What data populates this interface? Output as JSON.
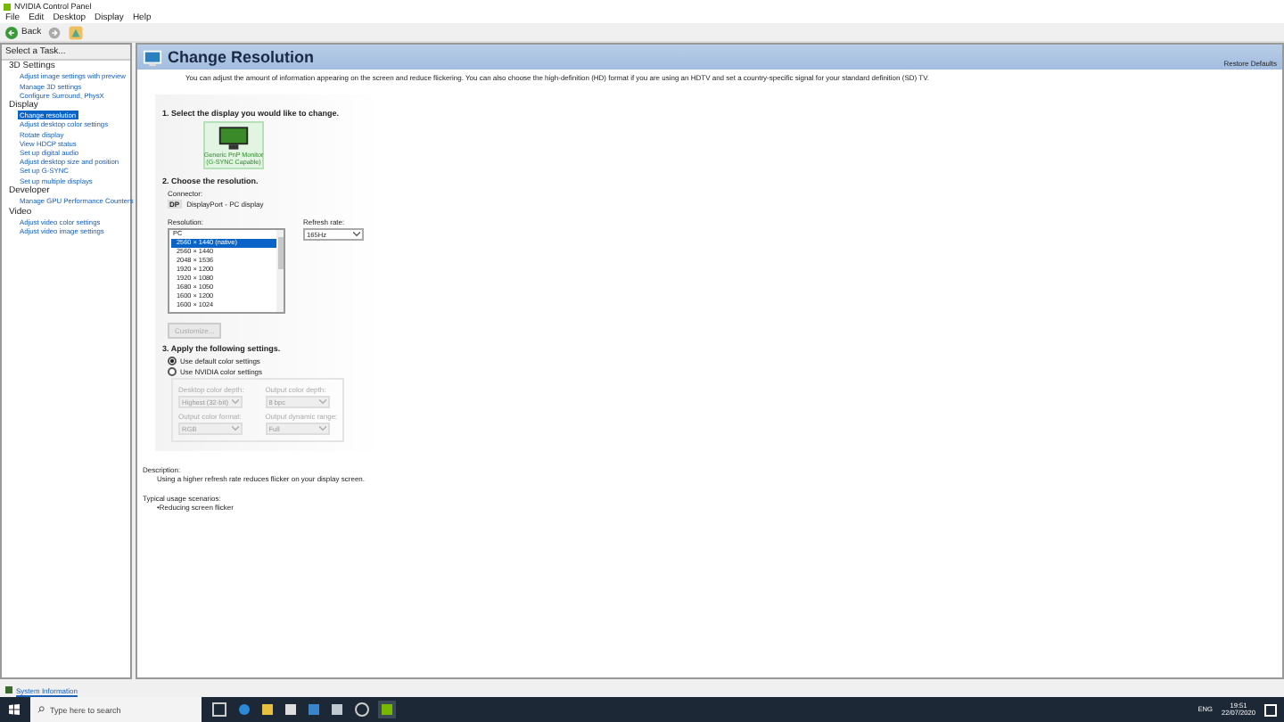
{
  "window": {
    "title": "NVIDIA Control Panel"
  },
  "menu": [
    "File",
    "Edit",
    "Desktop",
    "Display",
    "Help"
  ],
  "toolbar": {
    "back": "Back"
  },
  "sidebar": {
    "title": "Select a Task...",
    "items": [
      {
        "label": "3D Settings",
        "selected": false,
        "children": [
          {
            "label": "Adjust image settings with preview",
            "selected": false
          },
          {
            "label": "Manage 3D settings",
            "selected": false
          },
          {
            "label": "Configure Surround, PhysX",
            "selected": false
          }
        ]
      },
      {
        "label": "Display",
        "selected": false,
        "children": [
          {
            "label": "Change resolution",
            "selected": true
          },
          {
            "label": "Adjust desktop color settings",
            "selected": false
          },
          {
            "label": "Rotate display",
            "selected": false
          },
          {
            "label": "View HDCP status",
            "selected": false
          },
          {
            "label": "Set up digital audio",
            "selected": false
          },
          {
            "label": "Adjust desktop size and position",
            "selected": false
          },
          {
            "label": "Set up G-SYNC",
            "selected": false
          },
          {
            "label": "Set up multiple displays",
            "selected": false
          }
        ]
      },
      {
        "label": "Developer",
        "selected": false,
        "children": [
          {
            "label": "Manage GPU Performance Counters",
            "selected": false
          }
        ]
      },
      {
        "label": "Video",
        "selected": false,
        "children": [
          {
            "label": "Adjust video color settings",
            "selected": false
          },
          {
            "label": "Adjust video image settings",
            "selected": false
          }
        ]
      }
    ]
  },
  "page": {
    "title": "Change Resolution",
    "restore": "Restore Defaults",
    "intro": "You can adjust the amount of information appearing on the screen and reduce flickering. You can also choose the high-definition (HD) format if you are using an HDTV and set a country-specific signal for your standard definition (SD) TV.",
    "step1": "1. Select the display you would like to change.",
    "display": {
      "name": "Generic PnP Monitor",
      "sub": "(G-SYNC Capable)",
      "selected": true
    },
    "step2": "2. Choose the resolution.",
    "connector_label": "Connector:",
    "connector_badge": "DP",
    "connector": "DisplayPort - PC display",
    "resolution_label": "Resolution:",
    "resolution_group": "PC",
    "resolutions": [
      {
        "label": "2560 × 1440 (native)",
        "selected": true
      },
      {
        "label": "2560 × 1440",
        "selected": false
      },
      {
        "label": "2048 × 1536",
        "selected": false
      },
      {
        "label": "1920 × 1200",
        "selected": false
      },
      {
        "label": "1920 × 1080",
        "selected": false
      },
      {
        "label": "1680 × 1050",
        "selected": false
      },
      {
        "label": "1600 × 1200",
        "selected": false
      },
      {
        "label": "1600 × 1024",
        "selected": false
      }
    ],
    "refresh_label": "Refresh rate:",
    "refresh": "165Hz",
    "customize": "Customize...",
    "step3": "3. Apply the following settings.",
    "color_options": [
      {
        "label": "Use default color settings",
        "selected": true
      },
      {
        "label": "Use NVIDIA color settings",
        "selected": false
      }
    ],
    "color_fields": [
      {
        "label": "Desktop color depth:",
        "value": "Highest (32-bit)",
        "disabled": true
      },
      {
        "label": "Output color depth:",
        "value": "8 bpc",
        "disabled": true
      },
      {
        "label": "Output color format:",
        "value": "RGB",
        "disabled": true
      },
      {
        "label": "Output dynamic range:",
        "value": "Full",
        "disabled": true
      }
    ],
    "description_label": "Description:",
    "description": "Using a higher refresh rate reduces flicker on your display screen.",
    "usage_label": "Typical usage scenarios:",
    "usage": [
      "•Reducing screen flicker"
    ]
  },
  "footer": {
    "link": "System Information"
  },
  "taskbar": {
    "search": "Type here to search",
    "lang": "ENG",
    "time": "19:51",
    "date": "22/07/2020"
  }
}
